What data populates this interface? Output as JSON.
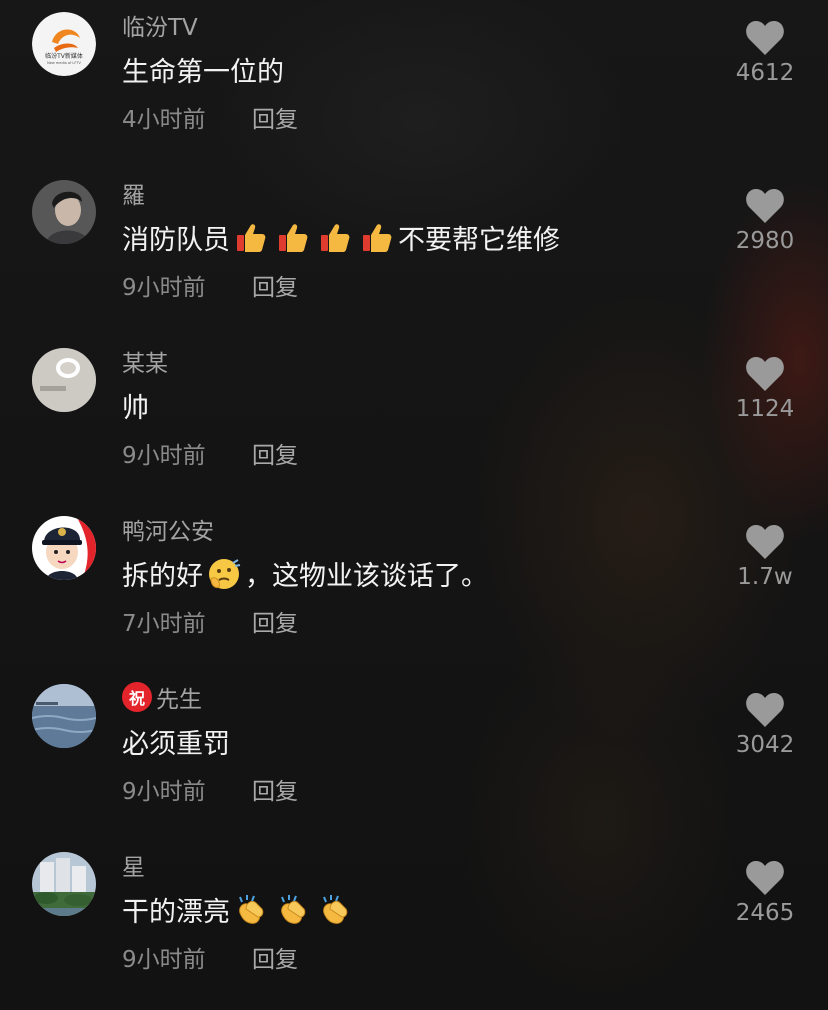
{
  "comments": [
    {
      "username": "临汾TV",
      "text": "生命第一位的",
      "time": "4小时前",
      "reply": "回复",
      "likes": "4612",
      "avatar": "logo-avatar",
      "avatar_logo_text": "临汾TV新媒体",
      "avatar_logo_subtext": "New media of LFTV"
    },
    {
      "username": "羅",
      "text_before": "消防队员",
      "emoji": "thumbs-up-icon",
      "emoji_count": 4,
      "text_after": "不要帮它维修",
      "time": "9小时前",
      "reply": "回复",
      "likes": "2980",
      "avatar": "person-avatar"
    },
    {
      "username": "某某",
      "text": "帅",
      "time": "9小时前",
      "reply": "回复",
      "likes": "1124",
      "avatar": "object-avatar"
    },
    {
      "username": "鸭河公安",
      "text_before": "拆的好",
      "emoji": "thinking-face-icon",
      "text_after": "，这物业该谈话了。",
      "time": "7小时前",
      "reply": "回复",
      "likes": "1.7w",
      "avatar": "police-cartoon-avatar"
    },
    {
      "username": "先生",
      "badge": "祝",
      "text": "必须重罚",
      "time": "9小时前",
      "reply": "回复",
      "likes": "3042",
      "avatar": "water-landscape-avatar"
    },
    {
      "username": "星",
      "text_before": "干的漂亮",
      "emoji": "clapping-hands-icon",
      "emoji_count": 3,
      "time": "9小时前",
      "reply": "回复",
      "likes": "2465",
      "avatar": "buildings-avatar"
    }
  ],
  "colors": {
    "background": "#161616",
    "username": "#a3a3a3",
    "text": "#f2f2f2",
    "meta": "#8a8a8a",
    "heart": "#9a9a9a",
    "badge": "#e3242b"
  }
}
